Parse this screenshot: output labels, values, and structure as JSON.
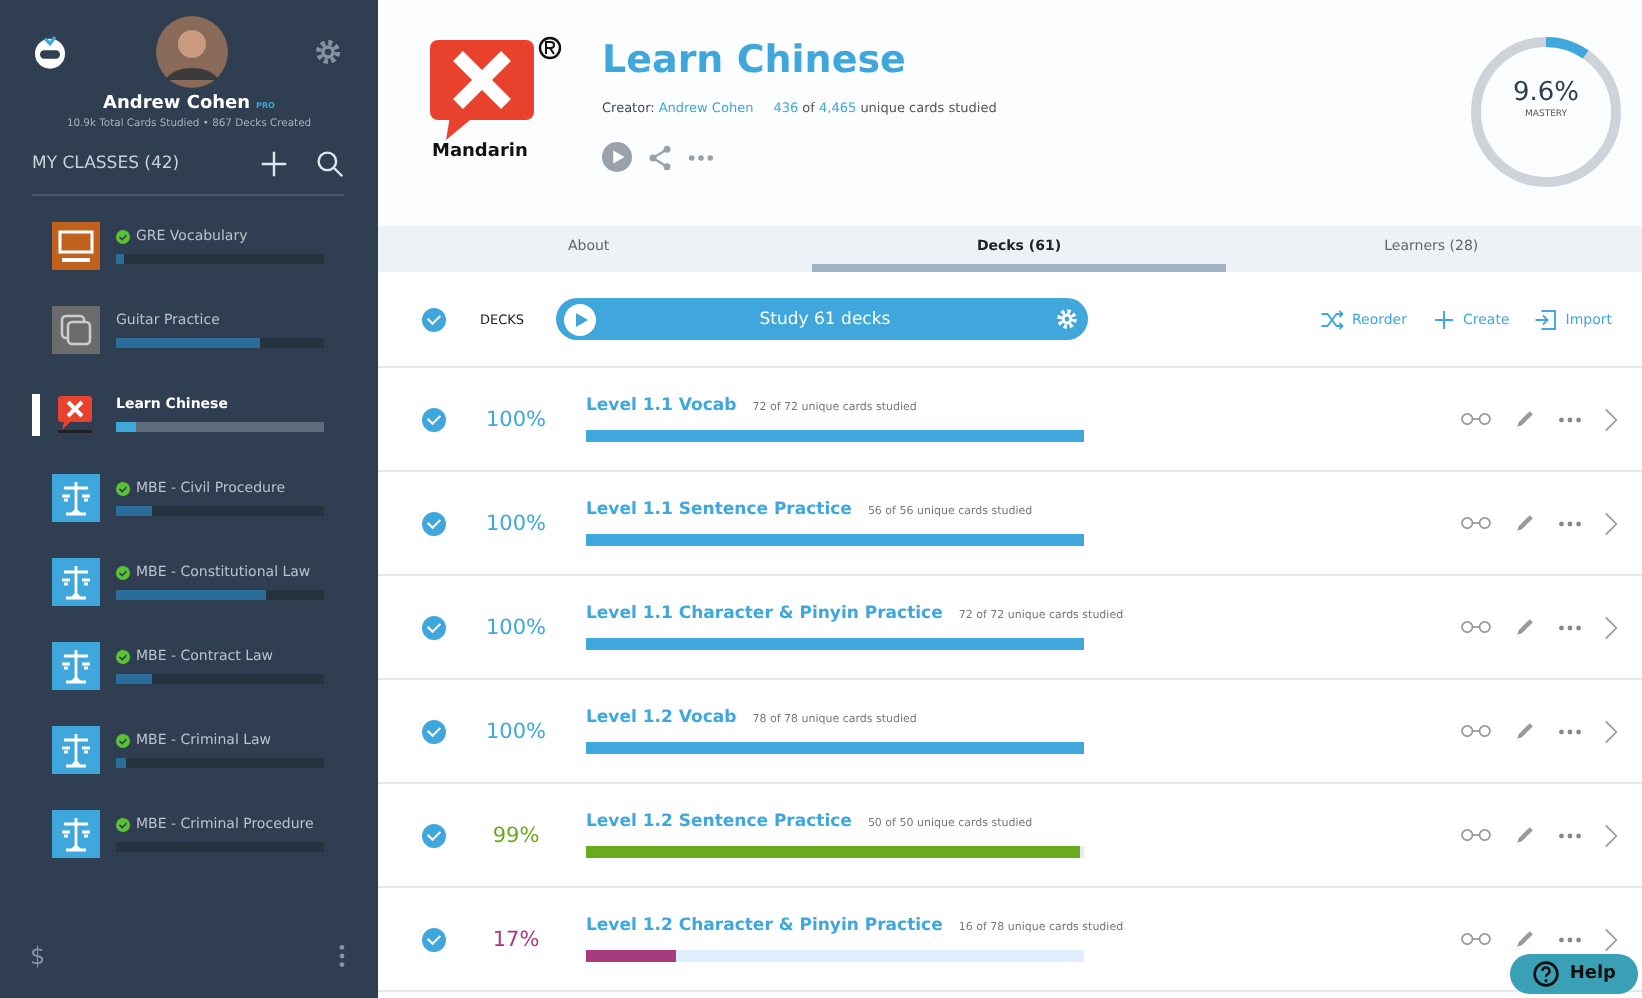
{
  "sidebar": {
    "user": {
      "name": "Andrew Cohen",
      "badge": "PRO",
      "stats": "10.9k Total Cards Studied • 867 Decks Created"
    },
    "classes_label": "MY CLASSES (42)",
    "classes": [
      {
        "name": "GRE Vocabulary",
        "kind": "gre",
        "verified": true,
        "level": 0.04,
        "selected": false
      },
      {
        "name": "Guitar Practice",
        "kind": "guitar",
        "verified": false,
        "level": 0.69,
        "selected": false
      },
      {
        "name": "Learn Chinese",
        "kind": "mandarin",
        "verified": false,
        "level": 0.1,
        "selected": true
      },
      {
        "name": "MBE - Civil Procedure",
        "kind": "law",
        "verified": true,
        "level": 0.17,
        "selected": false
      },
      {
        "name": "MBE - Constitutional Law",
        "kind": "law",
        "verified": true,
        "level": 0.72,
        "selected": false
      },
      {
        "name": "MBE - Contract Law",
        "kind": "law",
        "verified": true,
        "level": 0.17,
        "selected": false
      },
      {
        "name": "MBE - Criminal Law",
        "kind": "law",
        "verified": true,
        "level": 0.05,
        "selected": false
      },
      {
        "name": "MBE - Criminal Procedure",
        "kind": "law",
        "verified": true,
        "level": 0,
        "selected": false
      }
    ],
    "footer": {
      "currency": "$"
    }
  },
  "header": {
    "logo_text": "Mandarin",
    "title": "Learn Chinese",
    "creator_label": "Creator:",
    "creator": "Andrew Cohen",
    "studied": "436",
    "of": "of",
    "total": "4,465",
    "studied_label": "unique cards studied",
    "mastery": {
      "level": 0.096,
      "value": "9.6%",
      "label": "MASTERY"
    }
  },
  "tabs": [
    {
      "label": "About",
      "selected": false
    },
    {
      "label": "Decks (61)",
      "selected": true
    },
    {
      "label": "Learners (28)",
      "selected": false
    }
  ],
  "toolbar": {
    "checked": true,
    "label": "DECKS",
    "study": "Study 61 decks",
    "actions": [
      {
        "kind": "reorder",
        "label": "Reorder"
      },
      {
        "kind": "create",
        "label": "Create"
      },
      {
        "kind": "import",
        "label": "Import"
      }
    ]
  },
  "decks": [
    {
      "checked": true,
      "percent": "100%",
      "color": "#3fa7dc",
      "name": "Level 1.1 Vocab",
      "studied": "72 of 72 unique cards studied",
      "level": 1
    },
    {
      "checked": true,
      "percent": "100%",
      "color": "#3fa7dc",
      "name": "Level 1.1 Sentence Practice",
      "studied": "56 of 56 unique cards studied",
      "level": 1
    },
    {
      "checked": true,
      "percent": "100%",
      "color": "#3fa7dc",
      "name": "Level 1.1 Character & Pinyin Practice",
      "studied": "72 of 72 unique cards studied",
      "level": 1
    },
    {
      "checked": true,
      "percent": "100%",
      "color": "#3fa7dc",
      "name": "Level 1.2 Vocab",
      "studied": "78 of 78 unique cards studied",
      "level": 1
    },
    {
      "checked": true,
      "percent": "99%",
      "color": "#6aab1e",
      "name": "Level 1.2 Sentence Practice",
      "studied": "50 of 50 unique cards studied",
      "level": 0.99
    },
    {
      "checked": true,
      "percent": "17%",
      "color": "#a83a7e",
      "name": "Level 1.2 Character & Pinyin Practice",
      "studied": "16 of 78 unique cards studied",
      "level": 0.18
    }
  ],
  "help": {
    "label": "Help"
  }
}
